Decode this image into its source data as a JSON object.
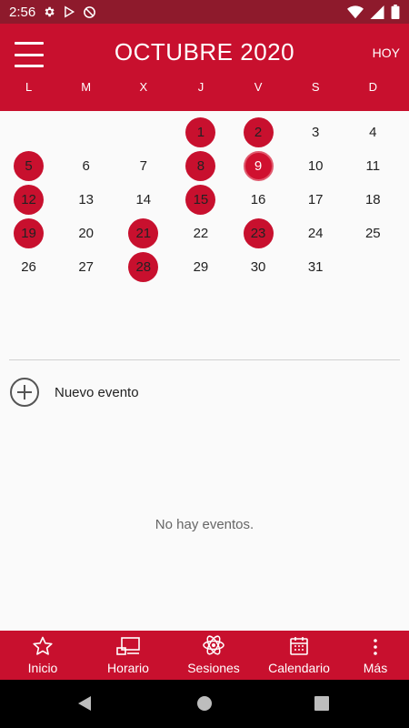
{
  "status_bar": {
    "time": "2:56"
  },
  "header": {
    "title": "OCTUBRE 2020",
    "today_label": "HOY",
    "weekdays": [
      "L",
      "M",
      "X",
      "J",
      "V",
      "S",
      "D"
    ]
  },
  "calendar": {
    "weeks": [
      [
        {
          "day": "",
          "marked": false
        },
        {
          "day": "",
          "marked": false
        },
        {
          "day": "",
          "marked": false
        },
        {
          "day": "1",
          "marked": true
        },
        {
          "day": "2",
          "marked": true
        },
        {
          "day": "3",
          "marked": false
        },
        {
          "day": "4",
          "marked": false
        }
      ],
      [
        {
          "day": "5",
          "marked": true
        },
        {
          "day": "6",
          "marked": false
        },
        {
          "day": "7",
          "marked": false
        },
        {
          "day": "8",
          "marked": true
        },
        {
          "day": "9",
          "marked": true,
          "today": true
        },
        {
          "day": "10",
          "marked": false
        },
        {
          "day": "11",
          "marked": false
        }
      ],
      [
        {
          "day": "12",
          "marked": true
        },
        {
          "day": "13",
          "marked": false
        },
        {
          "day": "14",
          "marked": false
        },
        {
          "day": "15",
          "marked": true
        },
        {
          "day": "16",
          "marked": false
        },
        {
          "day": "17",
          "marked": false
        },
        {
          "day": "18",
          "marked": false
        }
      ],
      [
        {
          "day": "19",
          "marked": true
        },
        {
          "day": "20",
          "marked": false
        },
        {
          "day": "21",
          "marked": true
        },
        {
          "day": "22",
          "marked": false
        },
        {
          "day": "23",
          "marked": true
        },
        {
          "day": "24",
          "marked": false
        },
        {
          "day": "25",
          "marked": false
        }
      ],
      [
        {
          "day": "26",
          "marked": false
        },
        {
          "day": "27",
          "marked": false
        },
        {
          "day": "28",
          "marked": true
        },
        {
          "day": "29",
          "marked": false
        },
        {
          "day": "30",
          "marked": false
        },
        {
          "day": "31",
          "marked": false
        },
        {
          "day": "",
          "marked": false
        }
      ]
    ]
  },
  "events": {
    "new_event_label": "Nuevo evento",
    "empty_text": "No hay eventos."
  },
  "bottom_nav": {
    "items": [
      {
        "label": "Inicio",
        "icon": "star-icon"
      },
      {
        "label": "Horario",
        "icon": "schedule-icon"
      },
      {
        "label": "Sesiones",
        "icon": "atom-icon"
      },
      {
        "label": "Calendario",
        "icon": "calendar-icon"
      },
      {
        "label": "Más",
        "icon": "more-vertical-icon"
      }
    ]
  },
  "colors": {
    "primary": "#c8102e",
    "status_bar": "#8e1a2c",
    "background": "#fafafa"
  }
}
